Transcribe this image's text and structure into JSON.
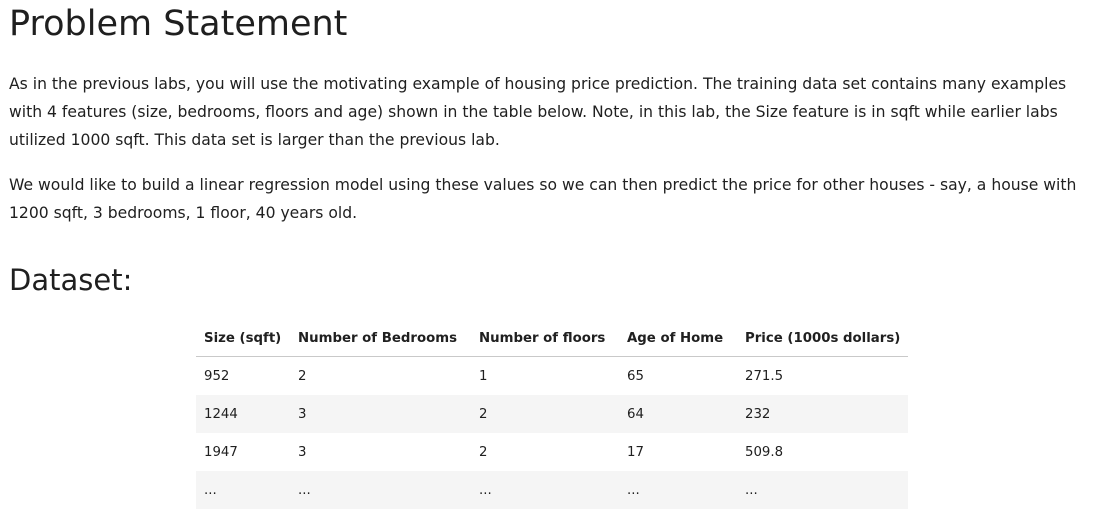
{
  "title": "Problem Statement",
  "paragraphs": [
    "As in the previous labs, you will use the motivating example of housing price prediction. The training data set contains many examples with 4 features (size, bedrooms, floors and age) shown in the table below. Note, in this lab, the Size feature is in sqft while earlier labs utilized 1000 sqft. This data set is larger than the previous lab.",
    "We would like to build a linear regression model using these values so we can then predict the price for other houses - say, a house with 1200 sqft, 3 bedrooms, 1 floor, 40 years old."
  ],
  "dataset_heading": "Dataset:",
  "table": {
    "headers": [
      "Size (sqft)",
      "Number of Bedrooms",
      "Number of floors",
      "Age of Home",
      "Price (1000s dollars)"
    ],
    "rows": [
      [
        "952",
        "2",
        "1",
        "65",
        "271.5"
      ],
      [
        "1244",
        "3",
        "2",
        "64",
        "232"
      ],
      [
        "1947",
        "3",
        "2",
        "17",
        "509.8"
      ],
      [
        "...",
        "...",
        "...",
        "...",
        "..."
      ]
    ]
  }
}
